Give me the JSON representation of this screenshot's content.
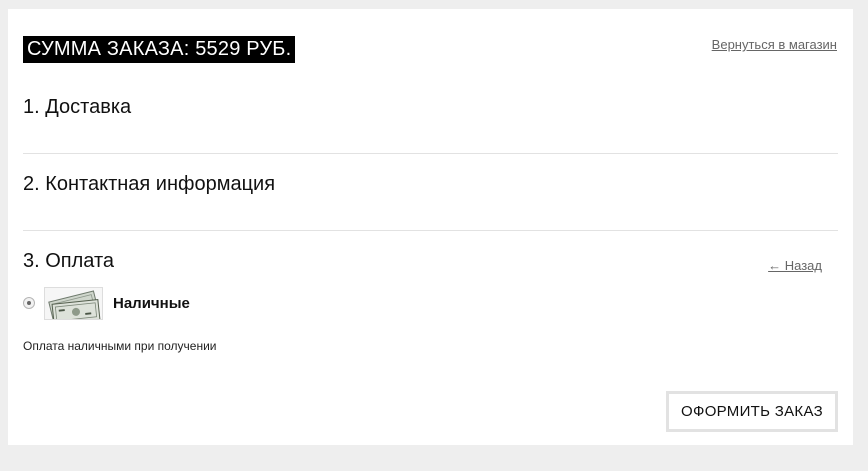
{
  "order": {
    "total_label": "СУММА ЗАКАЗА: 5529 РУБ."
  },
  "links": {
    "return_to_shop": "Вернуться в магазин",
    "back": "← Назад"
  },
  "steps": [
    {
      "title": "1. Доставка"
    },
    {
      "title": "2. Контактная информация"
    },
    {
      "title": "3. Оплата"
    }
  ],
  "payment": {
    "selected": true,
    "method_name": "Наличные",
    "method_icon": "cash-icon",
    "description": "Оплата наличными при получении"
  },
  "actions": {
    "submit_label": "ОФОРМИТЬ ЗАКАЗ"
  }
}
